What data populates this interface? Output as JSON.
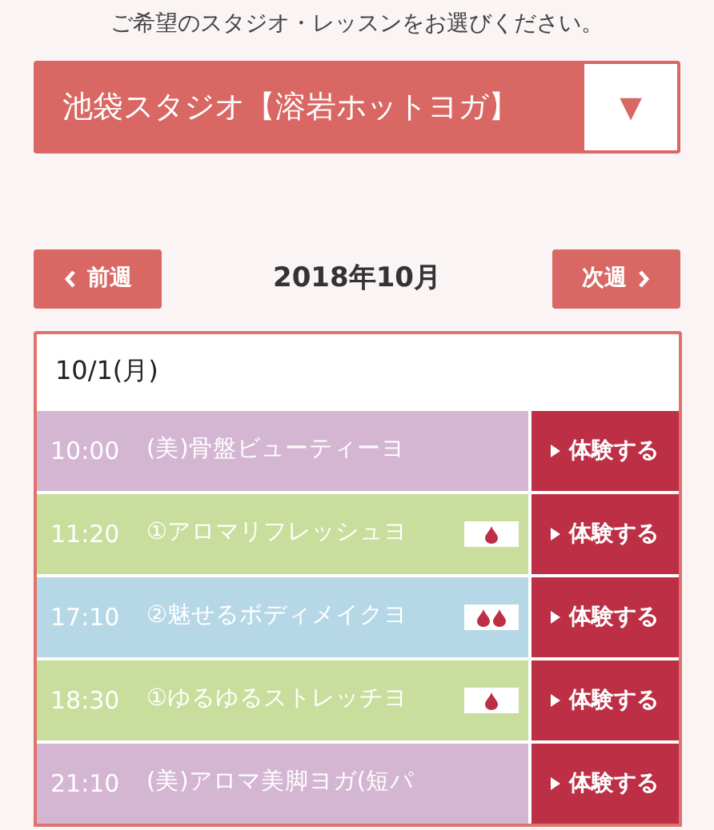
{
  "instruction": "ご希望のスタジオ・レッスンをお選びください。",
  "studio_select": {
    "value": "池袋スタジオ【溶岩ホットヨガ】",
    "arrow": "▼"
  },
  "week_nav": {
    "prev": "前週",
    "month": "2018年10月",
    "next": "次週"
  },
  "schedule": {
    "date": "10/1(月)",
    "rows": [
      {
        "time": "10:00",
        "lesson": "(美)骨盤ビューティーヨ",
        "color": "#d4b6d3",
        "kind": "plain",
        "action": "体験する"
      },
      {
        "time": "11:20",
        "lesson": "①アロマリフレッシュヨ",
        "color": "#c9de9c",
        "kind": "mild",
        "action": "体験する"
      },
      {
        "time": "17:10",
        "lesson": "②魅せるボディメイクヨ",
        "color": "#b5d7e6",
        "kind": "hot",
        "action": "体験する"
      },
      {
        "time": "18:30",
        "lesson": "①ゆるゆるストレッチヨ",
        "color": "#c9de9c",
        "kind": "mild",
        "action": "体験する"
      },
      {
        "time": "21:10",
        "lesson": "(美)アロマ美脚ヨガ(短パ",
        "color": "#d4b6d3",
        "kind": "plain",
        "action": "体験する"
      }
    ]
  }
}
